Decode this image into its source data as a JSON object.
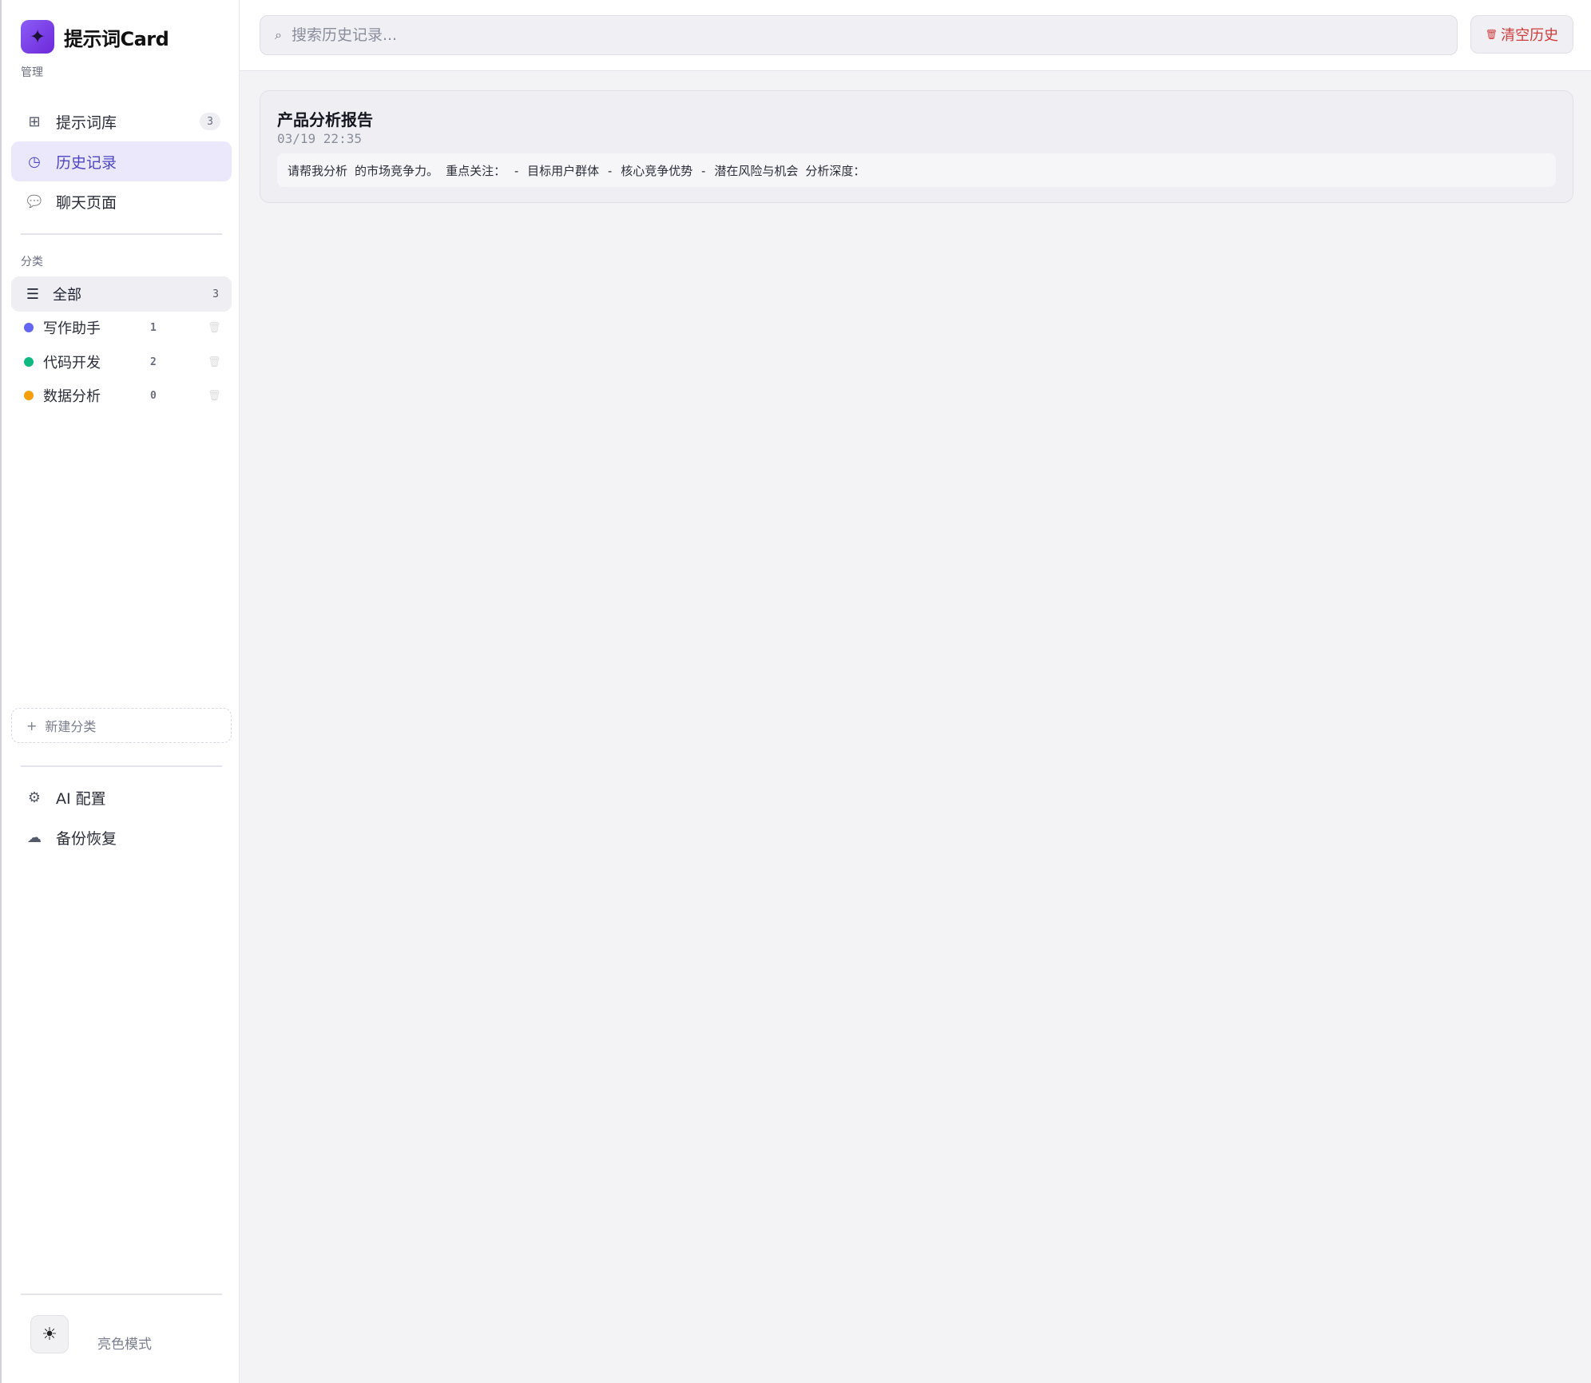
{
  "app": {
    "name": "提示词Card",
    "logo_glyph": "✦"
  },
  "sidebar": {
    "manage_label": "管理",
    "nav": [
      {
        "label": "提示词库",
        "icon": "grid-icon",
        "glyph": "⊞",
        "badge": "3"
      },
      {
        "label": "历史记录",
        "icon": "clock-icon",
        "glyph": "◷",
        "active": true
      },
      {
        "label": "聊天页面",
        "icon": "chat-bubble-icon",
        "glyph": "💬"
      }
    ],
    "category_label": "分类",
    "category_all": {
      "label": "全部",
      "glyph": "☰",
      "count": "3"
    },
    "categories": [
      {
        "label": "写作助手",
        "color": "#6366f1",
        "count": "1",
        "delete_glyph": "🗑"
      },
      {
        "label": "代码开发",
        "color": "#10b981",
        "count": "2",
        "delete_glyph": "🗑"
      },
      {
        "label": "数据分析",
        "color": "#f59e0b",
        "count": "0",
        "delete_glyph": "🗑"
      }
    ],
    "new_category": {
      "plus": "+",
      "label": "新建分类"
    },
    "settings": [
      {
        "label": "AI 配置",
        "icon": "gear-icon",
        "glyph": "⚙"
      },
      {
        "label": "备份恢复",
        "icon": "cloud-icon",
        "glyph": "☁"
      }
    ],
    "theme": {
      "glyph": "☀",
      "label": "亮色模式"
    }
  },
  "topbar": {
    "search_glyph": "⌕",
    "search_placeholder": "搜索历史记录...",
    "search_value": "",
    "clear_glyph": "🗑",
    "clear_label": "清空历史"
  },
  "history": [
    {
      "title": "产品分析报告",
      "time": "03/19 22:35",
      "preview": "请帮我分析 的市场竞争力。 重点关注： - 目标用户群体 - 核心竞争优势 - 潜在风险与机会 分析深度："
    }
  ],
  "colors": {
    "accent": "#4f46c5",
    "accent_bg": "#ebe8fb",
    "danger": "#d33a3a"
  }
}
